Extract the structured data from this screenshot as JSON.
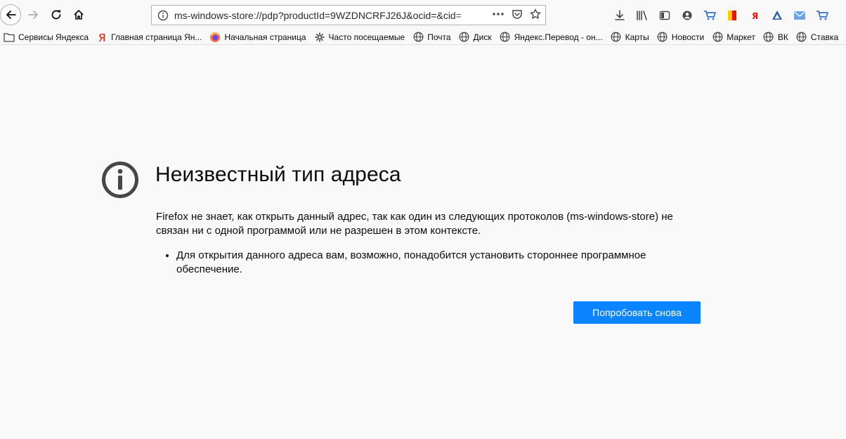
{
  "url": {
    "value": "ms-windows-store://pdp?productId=9WZDNCRFJ26J&ocid=&cid="
  },
  "bookmarks": [
    {
      "label": "Сервисы Яндекса",
      "icon": "folder-icon"
    },
    {
      "label": "Главная страница Ян...",
      "icon": "yandex-icon"
    },
    {
      "label": "Начальная страница",
      "icon": "firefox-icon"
    },
    {
      "label": "Часто посещаемые",
      "icon": "gear-icon"
    },
    {
      "label": "Почта",
      "icon": "globe-icon"
    },
    {
      "label": "Диск",
      "icon": "globe-icon"
    },
    {
      "label": "Яндекс.Перевод - он...",
      "icon": "globe-icon"
    },
    {
      "label": "Карты",
      "icon": "globe-icon"
    },
    {
      "label": "Новости",
      "icon": "globe-icon"
    },
    {
      "label": "Маркет",
      "icon": "globe-icon"
    },
    {
      "label": "ВК",
      "icon": "globe-icon"
    },
    {
      "label": "Ставка",
      "icon": "globe-icon"
    }
  ],
  "toolbar_icons": [
    "download-icon",
    "library-icon",
    "sidebar-icon",
    "account-icon",
    "market-cart-icon",
    "yandex-bar-icon",
    "yandex-y-icon",
    "yandex-disk-icon",
    "mail-icon",
    "cart-icon"
  ],
  "error": {
    "icon": "info-icon",
    "title": "Неизвестный тип адреса",
    "description": "Firefox не знает, как открыть данный адрес, так как один из следующих протоколов (ms-windows-store) не связан ни с одной программой или не разрешен в этом контексте.",
    "bullets": [
      "Для открытия данного адреса вам, возможно, понадобится установить стороннее программное обеспечение."
    ],
    "retry_label": "Попробовать снова"
  },
  "colors": {
    "accent": "#0a84ff",
    "page_bg": "#f9f9fa",
    "icon_gray": "#474749"
  }
}
